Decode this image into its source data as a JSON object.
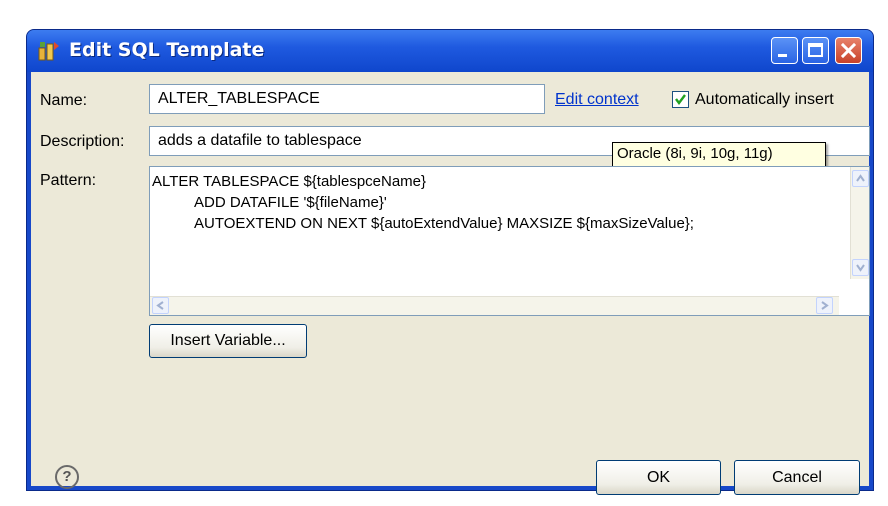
{
  "window": {
    "title": "Edit SQL Template"
  },
  "form": {
    "name_label": "Name:",
    "name_value": "ALTER_TABLESPACE",
    "edit_context_link": "Edit context",
    "auto_insert_label": "Automatically insert",
    "auto_insert_checked": true,
    "description_label": "Description:",
    "description_value": "adds a datafile to tablespace",
    "tooltip_text": "Oracle (8i, 9i, 10g, 11g)",
    "pattern_label": "Pattern:",
    "pattern_lines": [
      "ALTER TABLESPACE ${tablespceName}",
      "ADD DATAFILE '${fileName}'",
      "AUTOEXTEND ON NEXT ${autoExtendValue} MAXSIZE ${maxSizeValue};"
    ],
    "insert_variable_label": "Insert Variable..."
  },
  "buttons": {
    "ok_label": "OK",
    "cancel_label": "Cancel",
    "help_glyph": "?"
  },
  "icons": {
    "title": "sql-template-icon",
    "minimize": "minimize-icon",
    "maximize": "maximize-icon",
    "close": "close-icon",
    "help": "help-icon"
  },
  "colors": {
    "title_bar": "#1f5ae0",
    "dialog_bg": "#ece9d8",
    "link": "#0033cc",
    "close_button": "#c8422a",
    "tooltip_bg": "#ffffe1"
  }
}
